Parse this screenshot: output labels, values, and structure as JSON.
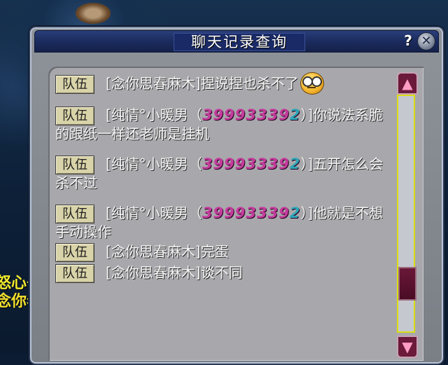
{
  "window": {
    "title": "聊天记录查询",
    "help_label": "?",
    "close_label": "✕"
  },
  "background": {
    "left_line1": "怒心书",
    "left_line2": "念你春"
  },
  "messages": [
    {
      "channel": "队伍",
      "text": "[念你思春麻木]捏说捏也杀不了",
      "emoticon": "glasses-face-emoticon"
    },
    {
      "channel": "队伍",
      "prefix": "[纯情°小暖男（",
      "number_main": "39993339",
      "number_last": "2",
      "suffix": "）]你说法系脆的跟纸一样还老师是挂机"
    },
    {
      "channel": "队伍",
      "prefix": "[纯情°小暖男（",
      "number_main": "39993339",
      "number_last": "2",
      "suffix": "）]五开怎么会杀不过"
    },
    {
      "channel": "队伍",
      "prefix": "[纯情°小暖男（",
      "number_main": "39993339",
      "number_last": "2",
      "suffix": "）]他就是不想手动操作"
    },
    {
      "channel": "队伍",
      "text": "[念你思春麻木]完蛋"
    },
    {
      "channel": "队伍",
      "text": "[念你思春麻木]谈不同"
    }
  ],
  "scrollbar": {
    "up_label": "▲",
    "down_label": "▼",
    "position_fraction": 0.75
  }
}
